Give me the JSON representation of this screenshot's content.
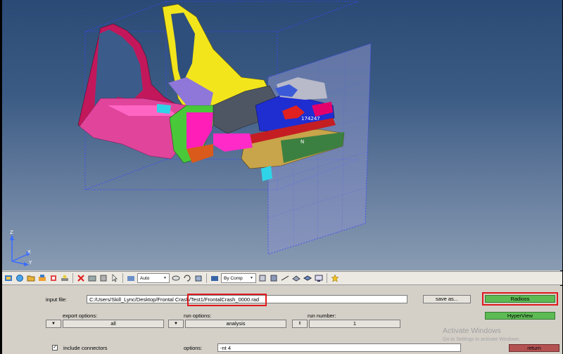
{
  "viewport": {
    "node_label": "174247",
    "node_short": "N",
    "axes": {
      "z": "Z",
      "x": "X",
      "y": "Y"
    }
  },
  "toolbar": {
    "icons": [
      "model-icon",
      "geometry-icon",
      "folder-icon",
      "component-icon",
      "property-icon",
      "connector-icon",
      "delete-icon",
      "hide-icon",
      "isolate-icon",
      "pointer-icon"
    ],
    "visual_mode": "Auto",
    "color_mode": "By Comp"
  },
  "panel": {
    "input_file_label": "input file:",
    "input_file_value": "C:/Users/Skill_Lync/Desktop/Frontal Crash/Test1/FrontalCrash_0000.rad",
    "save_as_label": "save as...",
    "solver_button": "Radioss",
    "hyperview_button": "HyperView",
    "export_options_label": "export options:",
    "export_options_value": "all",
    "run_options_label": "run options:",
    "run_options_value": "analysis",
    "run_number_label": "run number:",
    "run_number_value": "1",
    "include_connectors_label": "include connectors",
    "options_label": "options:",
    "options_value": "-nt 4",
    "return_button": "return",
    "arrow_glyph": "▼",
    "spinner_glyph": "⇕",
    "check_glyph": "✓"
  },
  "watermark": {
    "title": "Activate Windows",
    "subtitle": "Go to Settings to activate Windows."
  }
}
